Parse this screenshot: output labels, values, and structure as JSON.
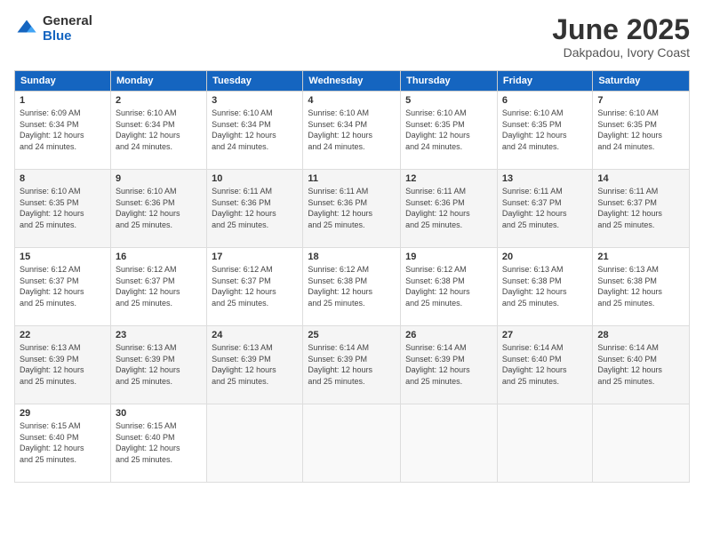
{
  "logo": {
    "general": "General",
    "blue": "Blue"
  },
  "title": "June 2025",
  "location": "Dakpadou, Ivory Coast",
  "days_header": [
    "Sunday",
    "Monday",
    "Tuesday",
    "Wednesday",
    "Thursday",
    "Friday",
    "Saturday"
  ],
  "weeks": [
    [
      {
        "day": "1",
        "info": "Sunrise: 6:09 AM\nSunset: 6:34 PM\nDaylight: 12 hours\nand 24 minutes."
      },
      {
        "day": "2",
        "info": "Sunrise: 6:10 AM\nSunset: 6:34 PM\nDaylight: 12 hours\nand 24 minutes."
      },
      {
        "day": "3",
        "info": "Sunrise: 6:10 AM\nSunset: 6:34 PM\nDaylight: 12 hours\nand 24 minutes."
      },
      {
        "day": "4",
        "info": "Sunrise: 6:10 AM\nSunset: 6:34 PM\nDaylight: 12 hours\nand 24 minutes."
      },
      {
        "day": "5",
        "info": "Sunrise: 6:10 AM\nSunset: 6:35 PM\nDaylight: 12 hours\nand 24 minutes."
      },
      {
        "day": "6",
        "info": "Sunrise: 6:10 AM\nSunset: 6:35 PM\nDaylight: 12 hours\nand 24 minutes."
      },
      {
        "day": "7",
        "info": "Sunrise: 6:10 AM\nSunset: 6:35 PM\nDaylight: 12 hours\nand 24 minutes."
      }
    ],
    [
      {
        "day": "8",
        "info": "Sunrise: 6:10 AM\nSunset: 6:35 PM\nDaylight: 12 hours\nand 25 minutes."
      },
      {
        "day": "9",
        "info": "Sunrise: 6:10 AM\nSunset: 6:36 PM\nDaylight: 12 hours\nand 25 minutes."
      },
      {
        "day": "10",
        "info": "Sunrise: 6:11 AM\nSunset: 6:36 PM\nDaylight: 12 hours\nand 25 minutes."
      },
      {
        "day": "11",
        "info": "Sunrise: 6:11 AM\nSunset: 6:36 PM\nDaylight: 12 hours\nand 25 minutes."
      },
      {
        "day": "12",
        "info": "Sunrise: 6:11 AM\nSunset: 6:36 PM\nDaylight: 12 hours\nand 25 minutes."
      },
      {
        "day": "13",
        "info": "Sunrise: 6:11 AM\nSunset: 6:37 PM\nDaylight: 12 hours\nand 25 minutes."
      },
      {
        "day": "14",
        "info": "Sunrise: 6:11 AM\nSunset: 6:37 PM\nDaylight: 12 hours\nand 25 minutes."
      }
    ],
    [
      {
        "day": "15",
        "info": "Sunrise: 6:12 AM\nSunset: 6:37 PM\nDaylight: 12 hours\nand 25 minutes."
      },
      {
        "day": "16",
        "info": "Sunrise: 6:12 AM\nSunset: 6:37 PM\nDaylight: 12 hours\nand 25 minutes."
      },
      {
        "day": "17",
        "info": "Sunrise: 6:12 AM\nSunset: 6:37 PM\nDaylight: 12 hours\nand 25 minutes."
      },
      {
        "day": "18",
        "info": "Sunrise: 6:12 AM\nSunset: 6:38 PM\nDaylight: 12 hours\nand 25 minutes."
      },
      {
        "day": "19",
        "info": "Sunrise: 6:12 AM\nSunset: 6:38 PM\nDaylight: 12 hours\nand 25 minutes."
      },
      {
        "day": "20",
        "info": "Sunrise: 6:13 AM\nSunset: 6:38 PM\nDaylight: 12 hours\nand 25 minutes."
      },
      {
        "day": "21",
        "info": "Sunrise: 6:13 AM\nSunset: 6:38 PM\nDaylight: 12 hours\nand 25 minutes."
      }
    ],
    [
      {
        "day": "22",
        "info": "Sunrise: 6:13 AM\nSunset: 6:39 PM\nDaylight: 12 hours\nand 25 minutes."
      },
      {
        "day": "23",
        "info": "Sunrise: 6:13 AM\nSunset: 6:39 PM\nDaylight: 12 hours\nand 25 minutes."
      },
      {
        "day": "24",
        "info": "Sunrise: 6:13 AM\nSunset: 6:39 PM\nDaylight: 12 hours\nand 25 minutes."
      },
      {
        "day": "25",
        "info": "Sunrise: 6:14 AM\nSunset: 6:39 PM\nDaylight: 12 hours\nand 25 minutes."
      },
      {
        "day": "26",
        "info": "Sunrise: 6:14 AM\nSunset: 6:39 PM\nDaylight: 12 hours\nand 25 minutes."
      },
      {
        "day": "27",
        "info": "Sunrise: 6:14 AM\nSunset: 6:40 PM\nDaylight: 12 hours\nand 25 minutes."
      },
      {
        "day": "28",
        "info": "Sunrise: 6:14 AM\nSunset: 6:40 PM\nDaylight: 12 hours\nand 25 minutes."
      }
    ],
    [
      {
        "day": "29",
        "info": "Sunrise: 6:15 AM\nSunset: 6:40 PM\nDaylight: 12 hours\nand 25 minutes."
      },
      {
        "day": "30",
        "info": "Sunrise: 6:15 AM\nSunset: 6:40 PM\nDaylight: 12 hours\nand 25 minutes."
      },
      {
        "day": "",
        "info": ""
      },
      {
        "day": "",
        "info": ""
      },
      {
        "day": "",
        "info": ""
      },
      {
        "day": "",
        "info": ""
      },
      {
        "day": "",
        "info": ""
      }
    ]
  ]
}
